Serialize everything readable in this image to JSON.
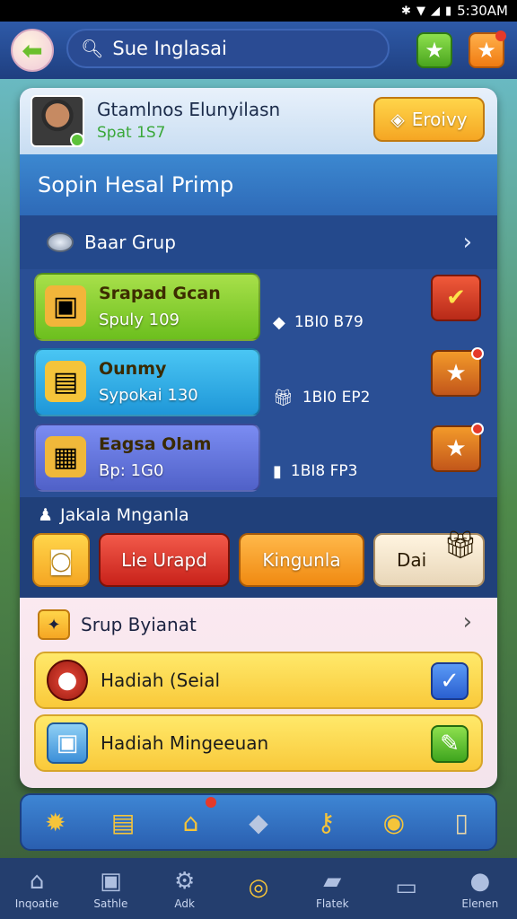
{
  "status_bar": {
    "time": "5:30AM",
    "icons": [
      "bluetooth-icon",
      "wifi-icon",
      "signal-icon",
      "battery-icon"
    ]
  },
  "header": {
    "search_text": "Sue Inglasai",
    "icons": [
      "back-arrow-icon",
      "search-icon",
      "star-icon",
      "star-icon"
    ]
  },
  "profile": {
    "name": "Gtamlnos Elunyilasn",
    "level": "Spat 1S7",
    "action_label": "Eroivy"
  },
  "section": {
    "title": "Sopin Hesal Primp"
  },
  "group": {
    "label": "Baar Grup"
  },
  "items": [
    {
      "title": "Srapad Gcan",
      "subtitle": "Spuly 109",
      "meta": "1BI0 B79",
      "colors": {
        "bg": "#6cbf1e"
      }
    },
    {
      "title": "Ounmy",
      "subtitle": "Sypokai 130",
      "meta": "1BI0 EP2",
      "colors": {
        "bg": "#1f97d8"
      }
    },
    {
      "title": "Eagsa Olam",
      "subtitle": "Bp: 1G0",
      "meta": "1BI8 FP3",
      "colors": {
        "bg": "#5061c8"
      }
    }
  ],
  "actions": {
    "heading": "Jakala Mnganla",
    "buttons": [
      "Lie Urapd",
      "Kingunla",
      "Dai"
    ]
  },
  "rewards": {
    "heading": "Srup Byianat",
    "items": [
      {
        "label": "Hadiah (Seial"
      },
      {
        "label": "Hadiah Mingeeuan"
      }
    ]
  },
  "quickbar": {
    "icons": [
      "badge-icon",
      "chest-icon",
      "shop-icon",
      "diamond-icon",
      "key-icon",
      "coin-icon",
      "scroll-icon"
    ]
  },
  "nav": [
    {
      "label": "Inqoatie",
      "icon": "home-icon"
    },
    {
      "label": "Sathle",
      "icon": "store-icon"
    },
    {
      "label": "Adk",
      "icon": "gear-icon"
    },
    {
      "label": "",
      "icon": "target-icon"
    },
    {
      "label": "Flatek",
      "icon": "folder-icon"
    },
    {
      "label": "",
      "icon": "card-icon"
    },
    {
      "label": "Elenen",
      "icon": "pin-icon"
    }
  ],
  "colors": {
    "header": "#2e5aa8",
    "panel": "#2a4f95",
    "accent_yellow": "#f5a623"
  }
}
